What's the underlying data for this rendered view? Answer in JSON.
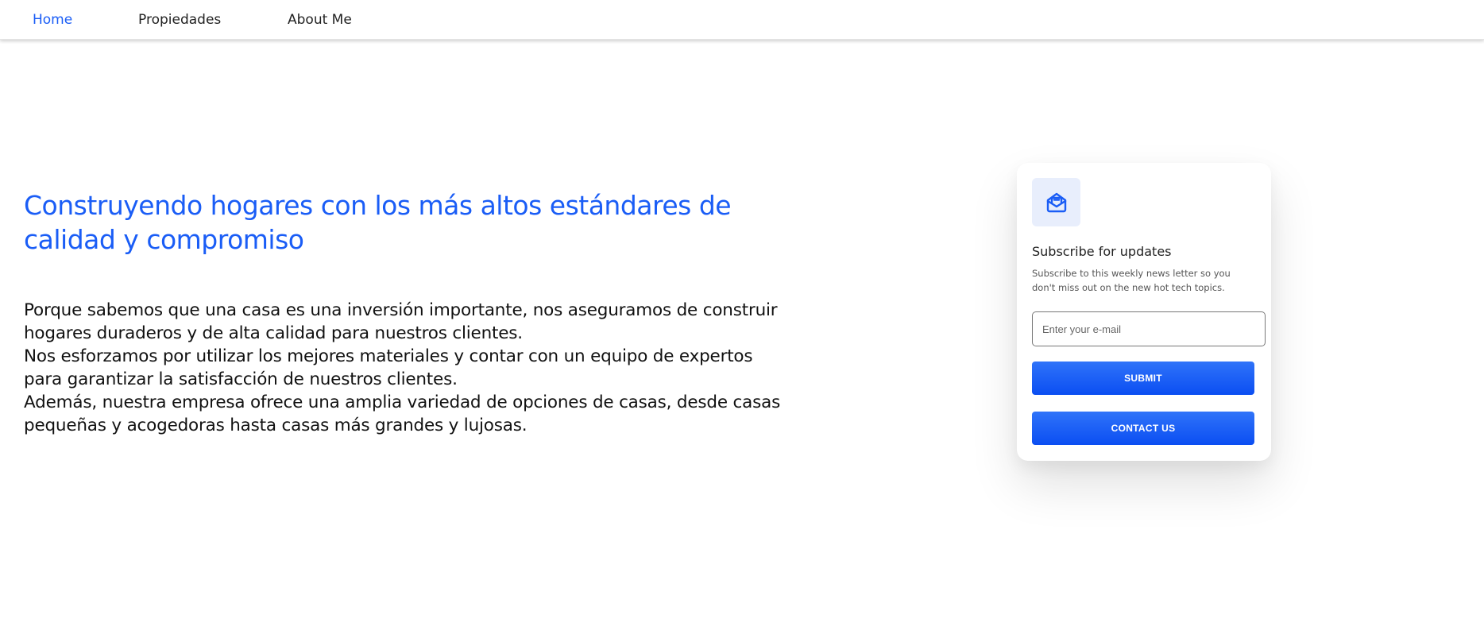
{
  "nav": {
    "items": [
      {
        "label": "Home",
        "active": true
      },
      {
        "label": "Propiedades",
        "active": false
      },
      {
        "label": "About Me",
        "active": false
      }
    ]
  },
  "hero": {
    "title": "Construyendo hogares con los más altos estándares de calidad y compromiso",
    "paragraphs": [
      "Porque sabemos que una casa es una inversión importante, nos aseguramos de construir hogares duraderos y de alta calidad para nuestros clientes.",
      "Nos esforzamos por utilizar los mejores materiales y contar con un equipo de expertos para garantizar la satisfacción de nuestros clientes.",
      "Además, nuestra empresa ofrece una amplia variedad de opciones de casas, desde casas pequeñas y acogedoras hasta casas más grandes y lujosas."
    ]
  },
  "subscribe": {
    "icon": "mail-open-icon",
    "title": "Subscribe for updates",
    "description": "Subscribe to this weekly news letter so you don't miss out on the new hot tech topics.",
    "email_placeholder": "Enter your e-mail",
    "email_value": "",
    "submit_label": "SUBMIT",
    "contact_label": "CONTACT US"
  },
  "colors": {
    "accent": "#1a5df6",
    "icon_bg": "#e8eefc",
    "button": "#0b4ef2"
  }
}
